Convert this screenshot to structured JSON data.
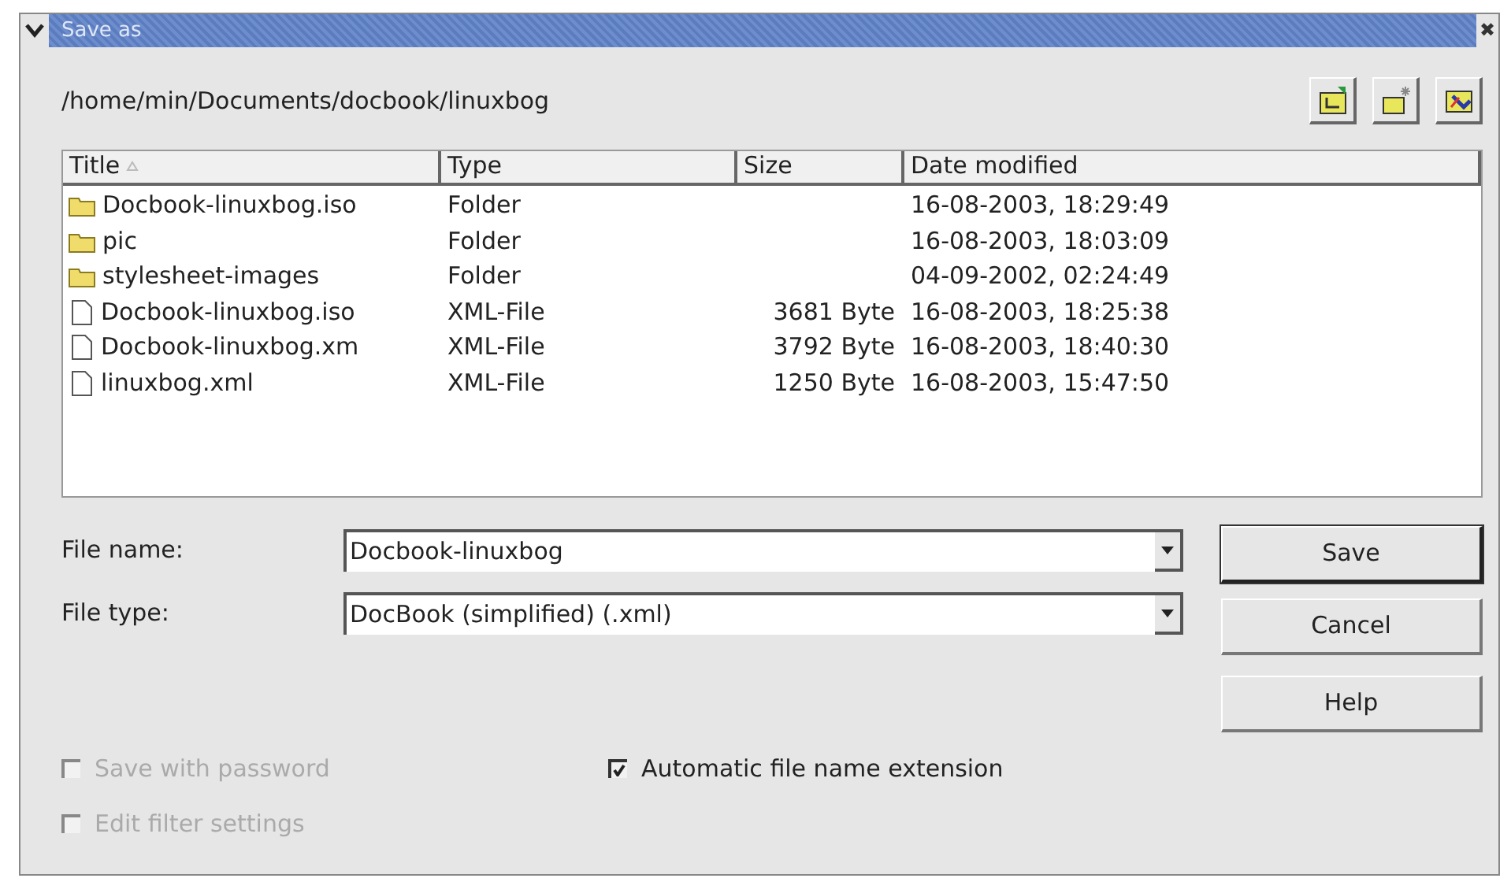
{
  "window": {
    "title": "Save as",
    "close": "✖"
  },
  "path": "/home/min/Documents/docbook/linuxbog",
  "toolbar": [
    {
      "kind": "up"
    },
    {
      "kind": "new"
    },
    {
      "kind": "default"
    }
  ],
  "table": {
    "columns": [
      "Title",
      "Type",
      "Size",
      "Date modified"
    ],
    "rows": [
      {
        "kind": "folder",
        "title": "Docbook-linuxbog.iso",
        "type": "Folder",
        "size": "",
        "date": "16-08-2003, 18:29:49"
      },
      {
        "kind": "folder",
        "title": "pic",
        "type": "Folder",
        "size": "",
        "date": "16-08-2003, 18:03:09"
      },
      {
        "kind": "folder",
        "title": "stylesheet-images",
        "type": "Folder",
        "size": "",
        "date": "04-09-2002, 02:24:49"
      },
      {
        "kind": "file",
        "title": "Docbook-linuxbog.iso",
        "type": "XML-File",
        "size": "3681 Byte",
        "date": "16-08-2003, 18:25:38"
      },
      {
        "kind": "file",
        "title": "Docbook-linuxbog.xm",
        "type": "XML-File",
        "size": "3792 Byte",
        "date": "16-08-2003, 18:40:30"
      },
      {
        "kind": "file",
        "title": "linuxbog.xml",
        "type": "XML-File",
        "size": "1250 Byte",
        "date": "16-08-2003, 15:47:50"
      }
    ]
  },
  "fields": [
    {
      "label": "File name:",
      "value": "Docbook-linuxbog"
    },
    {
      "label": "File type:",
      "value": "DocBook (simplified) (.xml)"
    }
  ],
  "buttons": [
    {
      "label": "Save",
      "default": true
    },
    {
      "label": "Cancel",
      "default": false
    },
    {
      "label": "Help",
      "default": false
    }
  ],
  "options": [
    {
      "label": "Save with password",
      "checked": false,
      "disabled": true
    },
    {
      "label": "Automatic file name extension",
      "checked": true,
      "disabled": false
    },
    {
      "label": "Edit filter settings",
      "checked": false,
      "disabled": true
    }
  ]
}
